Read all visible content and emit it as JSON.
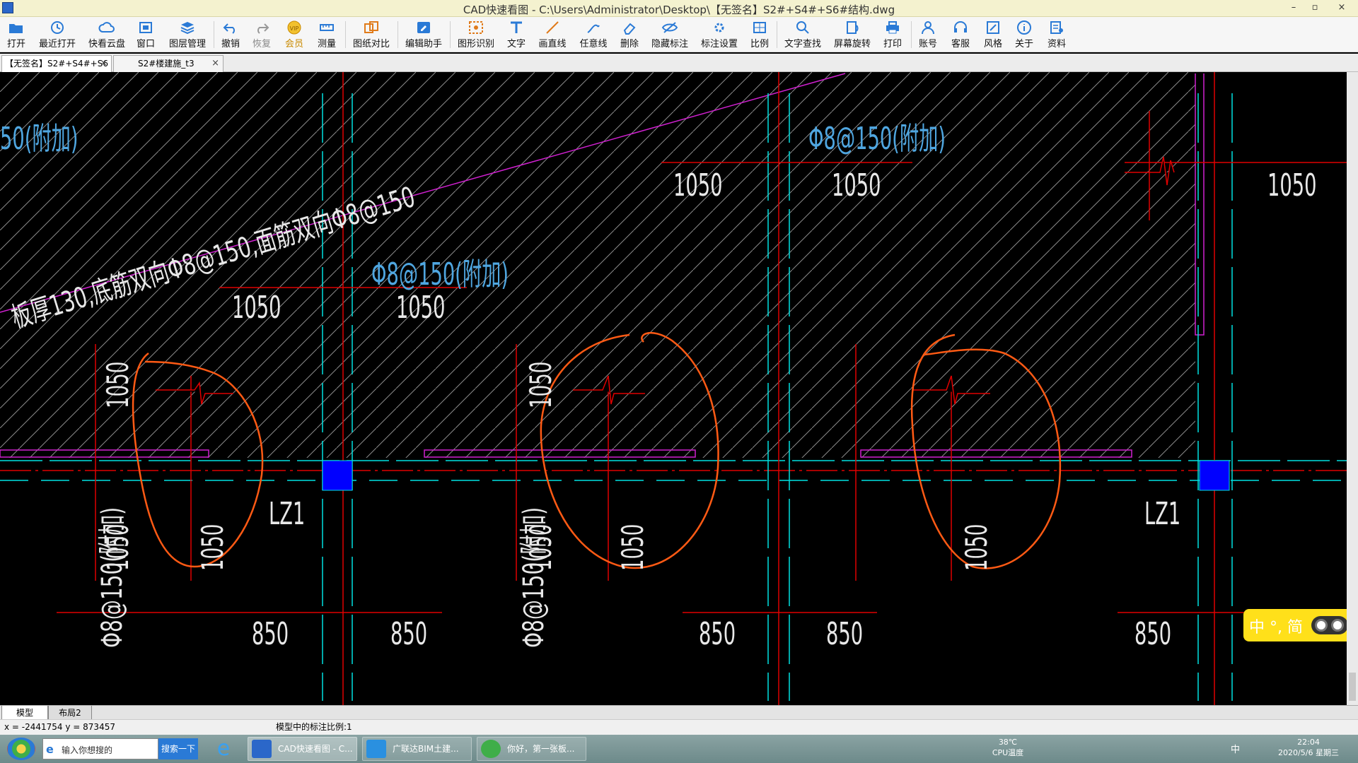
{
  "window": {
    "title": "CAD快速看图 - C:\\Users\\Administrator\\Desktop\\【无签名】S2#+S4#+S6#结构.dwg",
    "controls": [
      "–",
      "▫",
      "×"
    ]
  },
  "toolbar": [
    {
      "label": "打开",
      "icon": "folder-open-icon"
    },
    {
      "label": "最近打开",
      "icon": "history-icon"
    },
    {
      "label": "快看云盘",
      "icon": "cloud-icon"
    },
    {
      "label": "窗口",
      "icon": "window-icon"
    },
    {
      "label": "图层管理",
      "icon": "layers-icon"
    },
    {
      "label": "撤销",
      "icon": "undo-icon"
    },
    {
      "label": "恢复",
      "icon": "redo-icon"
    },
    {
      "label": "会员",
      "icon": "vip-icon"
    },
    {
      "label": "测量",
      "icon": "measure-icon"
    },
    {
      "label": "图纸对比",
      "icon": "compare-icon"
    },
    {
      "label": "编辑助手",
      "icon": "edit-assistant-icon"
    },
    {
      "label": "图形识别",
      "icon": "recognize-icon"
    },
    {
      "label": "文字",
      "icon": "text-icon"
    },
    {
      "label": "画直线",
      "icon": "line-icon"
    },
    {
      "label": "任意线",
      "icon": "freehand-icon"
    },
    {
      "label": "删除",
      "icon": "eraser-icon"
    },
    {
      "label": "隐藏标注",
      "icon": "hide-annotation-icon"
    },
    {
      "label": "标注设置",
      "icon": "annotation-settings-icon"
    },
    {
      "label": "比例",
      "icon": "scale-icon"
    },
    {
      "label": "文字查找",
      "icon": "text-search-icon"
    },
    {
      "label": "屏幕旋转",
      "icon": "rotate-screen-icon"
    },
    {
      "label": "打印",
      "icon": "print-icon"
    },
    {
      "label": "账号",
      "icon": "account-icon"
    },
    {
      "label": "客服",
      "icon": "headset-icon"
    },
    {
      "label": "风格",
      "icon": "style-icon"
    },
    {
      "label": "关于",
      "icon": "info-icon"
    },
    {
      "label": "资料",
      "icon": "resources-icon"
    }
  ],
  "doc_tabs": [
    {
      "label": "【无签名】S2#+S4#+S6",
      "active": true
    },
    {
      "label": "S2#楼建施_t3",
      "active": false
    }
  ],
  "drawing": {
    "slab_note": "板厚130,底筋双向Φ8@150,面筋双向Φ8@150",
    "rebar_labels": [
      "50(附加)",
      "Φ8@150(附加)",
      "Φ8@150(附加)",
      "Φ8@150(附加)",
      "Φ8@150(附加)"
    ],
    "dim_1050": "1050",
    "dim_850": "850",
    "column_label": "LZ1"
  },
  "layout_tabs": [
    "模型",
    "布局2"
  ],
  "status": {
    "coords": "x = -2441754  y = 873457",
    "scale": "模型中的标注比例:1"
  },
  "taskbar": {
    "search_placeholder": "输入你想搜的",
    "search_button": "搜索一下",
    "apps": [
      {
        "label": "CAD快速看图 - C...",
        "active": true
      },
      {
        "label": "广联达BIM土建...",
        "active": false
      },
      {
        "label": "你好，第一张板...",
        "active": false
      }
    ],
    "temp": "38℃",
    "cpu": "CPU温度",
    "time": "22:04",
    "date": "2020/5/6 星期三",
    "ime_lang": "中"
  },
  "ime_bar": {
    "text": "中 °, 简"
  },
  "colors": {
    "cyan": "#00e1e1",
    "red": "#e00000",
    "magenta": "#d020d0",
    "orange": "#ff5a14",
    "blue_label": "#4fa6e0",
    "white": "#e8e8e8"
  }
}
